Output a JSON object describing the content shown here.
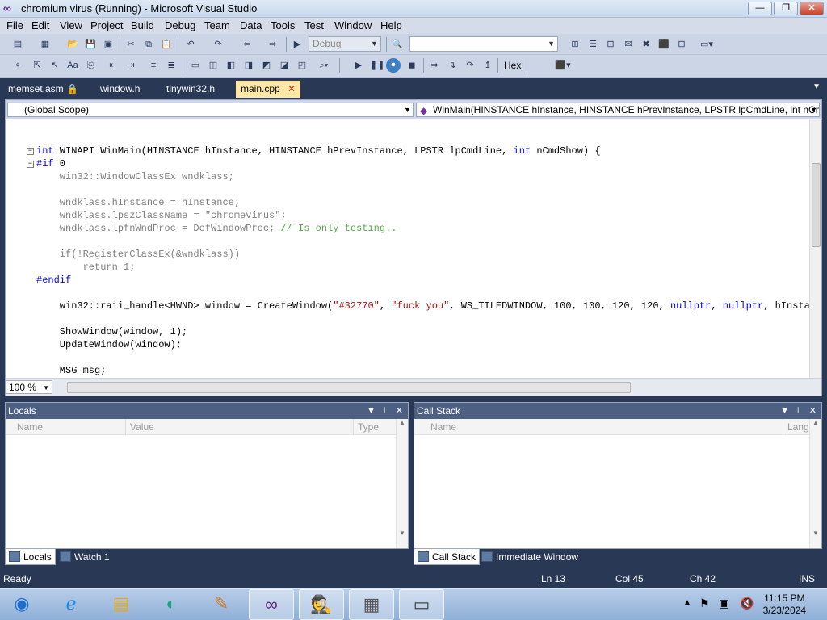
{
  "window": {
    "title": "chromium virus (Running) - Microsoft Visual Studio",
    "min": "0",
    "max": "1",
    "close": "r"
  },
  "menu": [
    "File",
    "Edit",
    "View",
    "Project",
    "Build",
    "Debug",
    "Team",
    "Data",
    "Tools",
    "Test",
    "Window",
    "Help"
  ],
  "toolbar": {
    "config_value": "Debug",
    "hex_label": "Hex"
  },
  "tabs": [
    {
      "label": "memset.asm",
      "active": false,
      "locked": true
    },
    {
      "label": "window.h",
      "active": false
    },
    {
      "label": "tinywin32.h",
      "active": false
    },
    {
      "label": "main.cpp",
      "active": true
    }
  ],
  "nav": {
    "scope": "(Global Scope)",
    "member": "WinMain(HINSTANCE hInstance, HINSTANCE hPrevInstance, LPSTR lpCmdLine, int nCm"
  },
  "code": {
    "l1_kw": "int",
    "l1_rest": " WINAPI WinMain(HINSTANCE hInstance, HINSTANCE hPrevInstance, LPSTR lpCmdLine, ",
    "l1_kw2": "int",
    "l1_end": " nCmdShow) {",
    "l2_kw": "#if",
    "l2_rest": " 0",
    "l3": "    win32::WindowClassEx wndklass;",
    "l4": "    wndklass.hInstance = hInstance;",
    "l5_a": "    wndklass.lpszClassName = ",
    "l5_str": "\"chromevirus\"",
    "l5_b": ";",
    "l6_a": "    wndklass.lpfnWndProc = DefWindowProc; ",
    "l6_cm": "// Is only testing..",
    "l7": "    if(!RegisterClassEx(&wndklass))",
    "l8": "        return 1;",
    "l9": "#endif",
    "l10_a": "    win32::raii_handle<HWND> window = CreateWindow(",
    "l10_s1": "\"#32770\"",
    "l10_b": ", ",
    "l10_s2": "\"fuck you\"",
    "l10_c": ", WS_TILEDWINDOW, 100, 100, 120, 120, ",
    "l10_k1": "nullptr",
    "l10_d": ", ",
    "l10_k2": "nullptr",
    "l10_e": ", hInstance,",
    "l11": "    ShowWindow(window, 1);",
    "l12": "    UpdateWindow(window);",
    "l13": "    MSG msg;"
  },
  "editor": {
    "zoom": "100 %"
  },
  "locals": {
    "title": "Locals",
    "cols": [
      "Name",
      "Value",
      "Type"
    ]
  },
  "callstack": {
    "title": "Call Stack",
    "cols": [
      "Name",
      "Lang"
    ]
  },
  "bottom_tabs_left": [
    "Locals",
    "Watch 1"
  ],
  "bottom_tabs_right": [
    "Call Stack",
    "Immediate Window"
  ],
  "status": {
    "ready": "Ready",
    "ln": "Ln 13",
    "col": "Col 45",
    "ch": "Ch 42",
    "ins": "INS"
  },
  "taskbar": {
    "time": "11:15 PM",
    "date": "3/23/2024"
  }
}
